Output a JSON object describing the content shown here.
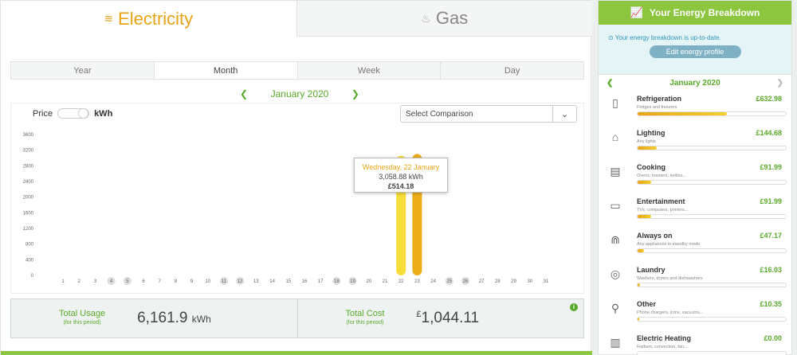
{
  "fuel_tabs": [
    {
      "label": "Electricity",
      "icon": "bolt-icon",
      "active": true
    },
    {
      "label": "Gas",
      "icon": "flame-icon",
      "active": false
    }
  ],
  "periods": [
    {
      "label": "Year",
      "active": false
    },
    {
      "label": "Month",
      "active": true
    },
    {
      "label": "Week",
      "active": false
    },
    {
      "label": "Day",
      "active": false
    }
  ],
  "month_nav": {
    "label": "January 2020"
  },
  "price_toggle": {
    "left": "Price",
    "right": "kWh"
  },
  "comparison": {
    "label": "Select Comparison"
  },
  "tooltip": {
    "date": "Wednesday, 22 January",
    "usage": "3,058.88 kWh",
    "cost": "£514.18"
  },
  "summary": {
    "usage": {
      "label": "Total Usage",
      "sub": "(for this period)",
      "value": "6,161.9",
      "unit": "kWh"
    },
    "cost": {
      "label": "Total Cost",
      "sub": "(for this period)",
      "currency": "£",
      "value": "1,044.11"
    }
  },
  "chart_data": {
    "type": "bar",
    "categories": [
      "1",
      "2",
      "3",
      "4",
      "5",
      "6",
      "7",
      "8",
      "9",
      "10",
      "11",
      "12",
      "13",
      "14",
      "15",
      "16",
      "17",
      "18",
      "19",
      "20",
      "21",
      "22",
      "23",
      "24",
      "25",
      "26",
      "27",
      "28",
      "29",
      "30",
      "31"
    ],
    "highlighted": [
      "4",
      "5",
      "11",
      "12",
      "18",
      "19",
      "25",
      "26"
    ],
    "values": [
      0,
      0,
      0,
      0,
      0,
      0,
      0,
      0,
      0,
      0,
      0,
      0,
      0,
      0,
      0,
      0,
      0,
      0,
      0,
      0,
      0,
      3058.88,
      3103.02,
      0,
      0,
      0,
      0,
      0,
      0,
      0,
      0
    ],
    "yticks": [
      "0",
      "400",
      "800",
      "1200",
      "1600",
      "2000",
      "2400",
      "2800",
      "3200",
      "3600"
    ],
    "ylim": [
      0,
      3600
    ],
    "colors": {
      "light": "#f7de3a",
      "dark": "#ecae17"
    }
  },
  "breakdown": {
    "title": "Your Energy Breakdown",
    "status": "Your energy breakdown is up-to-date.",
    "edit_label": "Edit energy profile",
    "month": "January 2020",
    "items": [
      {
        "name": "Refrigeration",
        "desc": "Fridges and freezers",
        "amount": "£632.98",
        "pct": 0.6,
        "icon": "fridge-icon"
      },
      {
        "name": "Lighting",
        "desc": "Any lights",
        "amount": "£144.68",
        "pct": 0.13,
        "icon": "ceiling-light-icon"
      },
      {
        "name": "Cooking",
        "desc": "Ovens, toasters, kettles...",
        "amount": "£91.99",
        "pct": 0.09,
        "icon": "oven-icon"
      },
      {
        "name": "Entertainment",
        "desc": "TVs, computers, printers...",
        "amount": "£91.99",
        "pct": 0.09,
        "icon": "tv-icon"
      },
      {
        "name": "Always on",
        "desc": "Any appliances in standby mode",
        "amount": "£47.17",
        "pct": 0.045,
        "icon": "router-icon"
      },
      {
        "name": "Laundry",
        "desc": "Washers, dryers and dishwashers",
        "amount": "£16.03",
        "pct": 0.015,
        "icon": "washing-machine-icon"
      },
      {
        "name": "Other",
        "desc": "Phone chargers, irons, vacuums...",
        "amount": "£10.35",
        "pct": 0.01,
        "icon": "plug-icon"
      },
      {
        "name": "Electric Heating",
        "desc": "Radiant, convection, fan...",
        "amount": "£0.00",
        "pct": 0,
        "icon": "radiator-icon"
      }
    ]
  }
}
